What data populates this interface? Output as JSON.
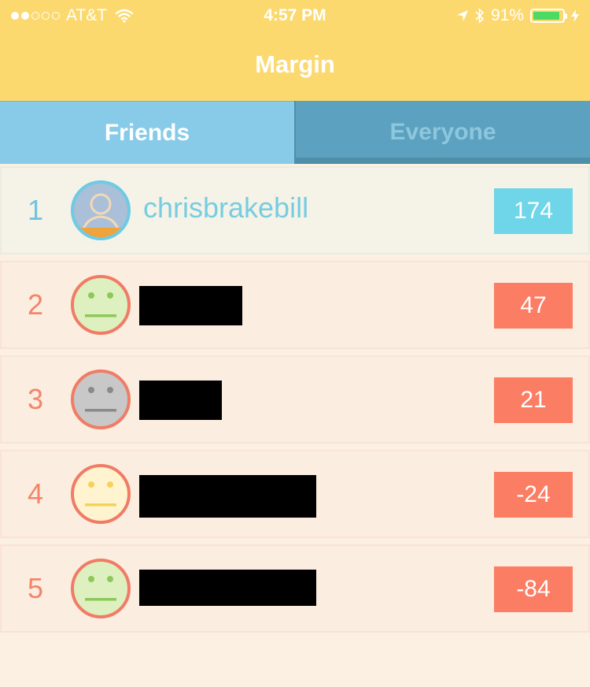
{
  "status_bar": {
    "signal_dots_filled": 2,
    "signal_dots_total": 5,
    "carrier": "AT&T",
    "time": "4:57 PM",
    "battery": "91%",
    "battery_level": 0.91,
    "icons": [
      "wifi-icon",
      "location-arrow-icon",
      "bluetooth-icon",
      "battery-icon",
      "charging-bolt-icon"
    ]
  },
  "nav": {
    "title": "Margin"
  },
  "tabs": [
    {
      "label": "Friends",
      "active": true
    },
    {
      "label": "Everyone",
      "active": false
    }
  ],
  "leaderboard": [
    {
      "rank": "1",
      "name": "chrisbrakebill",
      "score": "174",
      "avatar": "profile-photo",
      "is_me": true
    },
    {
      "rank": "2",
      "name": "",
      "score": "47",
      "avatar": "face-green",
      "redacted": true
    },
    {
      "rank": "3",
      "name": "",
      "score": "21",
      "avatar": "face-gray",
      "redacted": true
    },
    {
      "rank": "4",
      "name": "",
      "score": "-24",
      "avatar": "face-yellow",
      "redacted": true
    },
    {
      "rank": "5",
      "name": "",
      "score": "-84",
      "avatar": "face-green",
      "redacted": true
    }
  ],
  "colors": {
    "header_yellow": "#fcd96f",
    "tab_active": "#87cbe9",
    "tab_inactive": "#5ca1bf",
    "score_positive_me": "#6fd5e8",
    "score_other": "#fb7d64",
    "face_green": "#dff0c0",
    "face_gray": "#c8c8c8",
    "face_yellow": "#fff4cf"
  }
}
